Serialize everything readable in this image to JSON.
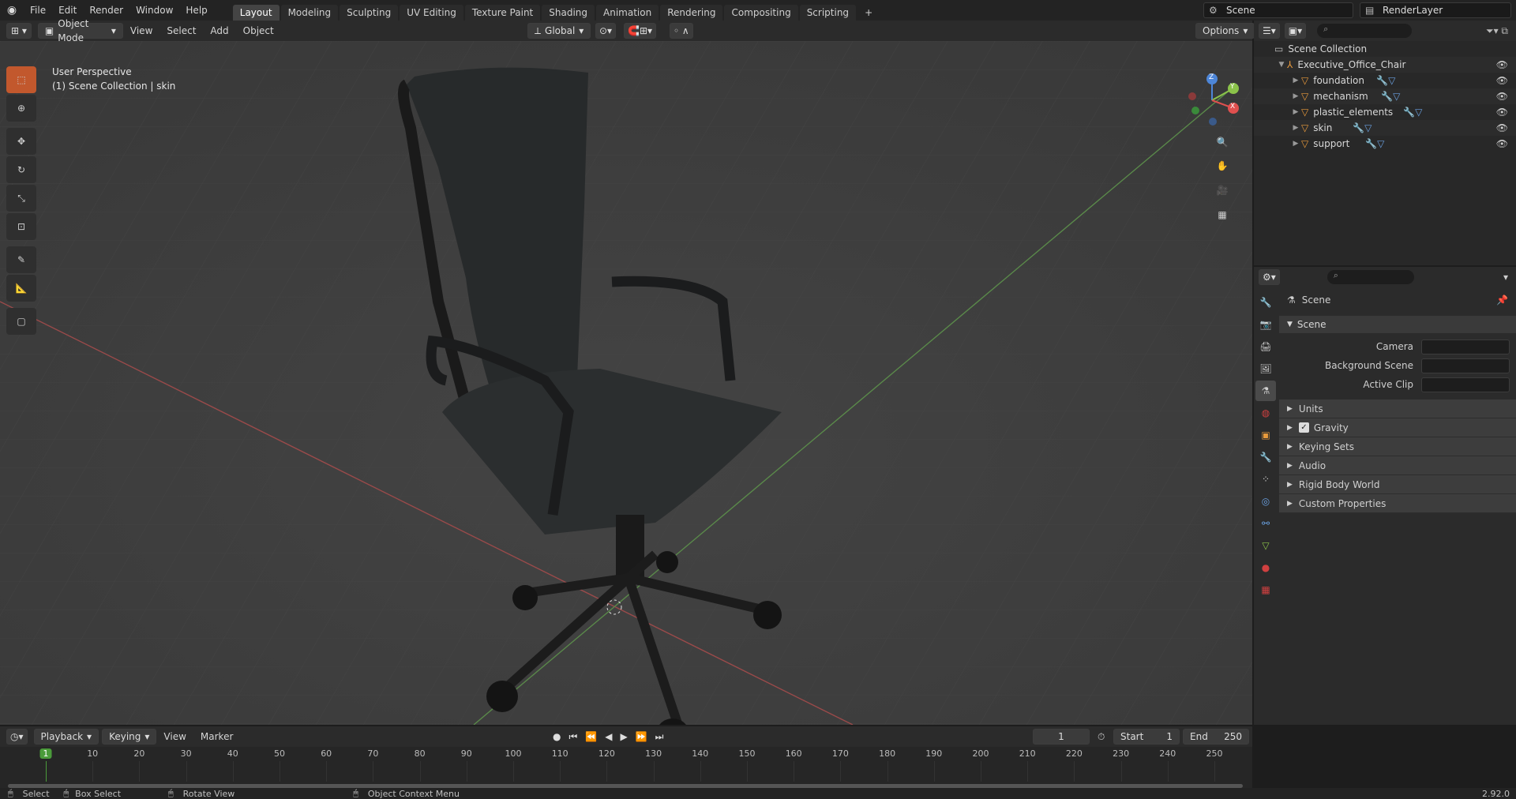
{
  "menubar": {
    "items": [
      "File",
      "Edit",
      "Render",
      "Window",
      "Help"
    ],
    "workspaces": [
      "Layout",
      "Modeling",
      "Sculpting",
      "UV Editing",
      "Texture Paint",
      "Shading",
      "Animation",
      "Rendering",
      "Compositing",
      "Scripting"
    ],
    "active_workspace": "Layout",
    "scene_name": "Scene",
    "view_layer": "RenderLayer"
  },
  "viewport_header": {
    "mode": "Object Mode",
    "menus": [
      "View",
      "Select",
      "Add",
      "Object"
    ],
    "transform_orientation": "Global",
    "options_label": "Options"
  },
  "viewport": {
    "perspective_label": "User Perspective",
    "collection_label": "(1) Scene Collection | skin",
    "gizmo_axes": {
      "x": "X",
      "y": "Y",
      "z": "Z"
    }
  },
  "outliner": {
    "root": "Scene Collection",
    "collection": "Executive_Office_Chair",
    "objects": [
      "foundation",
      "mechanism",
      "plastic_elements",
      "skin",
      "support"
    ]
  },
  "properties": {
    "context": "Scene",
    "section": "Scene",
    "fields": [
      {
        "label": "Camera"
      },
      {
        "label": "Background Scene"
      },
      {
        "label": "Active Clip"
      }
    ],
    "subpanels": [
      "Units",
      "Gravity",
      "Keying Sets",
      "Audio",
      "Rigid Body World",
      "Custom Properties"
    ]
  },
  "timeline": {
    "menus": [
      "Playback",
      "Keying",
      "View",
      "Marker"
    ],
    "current_frame": "1",
    "start_label": "Start",
    "start_value": "1",
    "end_label": "End",
    "end_value": "250",
    "ticks": [
      "1",
      "10",
      "20",
      "30",
      "40",
      "50",
      "60",
      "70",
      "80",
      "90",
      "100",
      "110",
      "120",
      "130",
      "140",
      "150",
      "160",
      "170",
      "180",
      "190",
      "200",
      "210",
      "220",
      "230",
      "240",
      "250"
    ]
  },
  "statusbar": {
    "select": "Select",
    "box_select": "Box Select",
    "rotate_view": "Rotate View",
    "context_menu": "Object Context Menu",
    "version": "2.92.0"
  },
  "colors": {
    "accent": "#c2582d",
    "object_orange": "#e89a3c",
    "axis_x": "#e0504f",
    "axis_y": "#8bc34a",
    "axis_z": "#4d86d8"
  }
}
